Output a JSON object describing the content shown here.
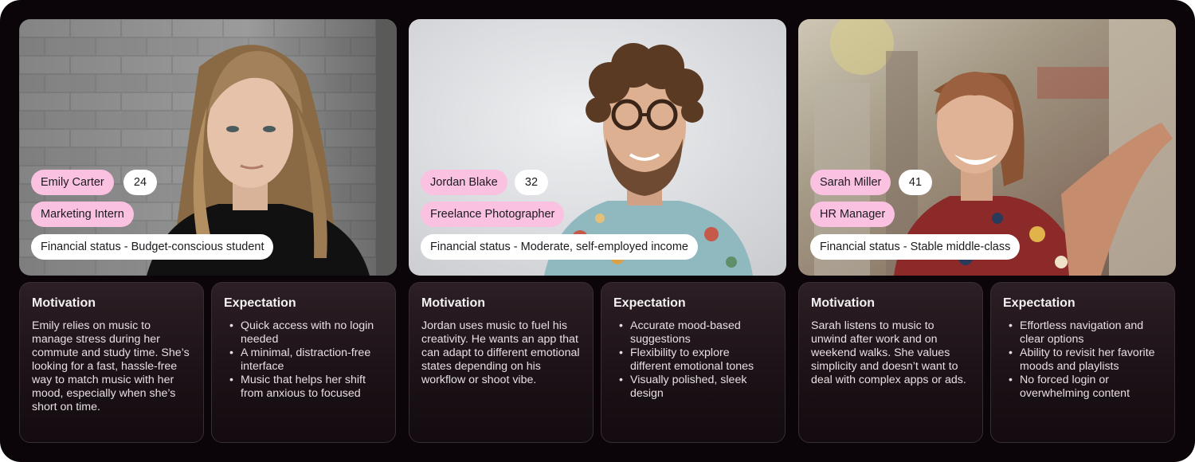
{
  "personas": [
    {
      "name": "Emily Carter",
      "age": "24",
      "role": "Marketing Intern",
      "financial_status": "Financial status - Budget-conscious student",
      "motivation_title": "Motivation",
      "motivation_text": "Emily relies on music to manage stress during her commute and study time. She’s looking for a fast, hassle-free way to match music with her mood, especially when she’s short on time.",
      "expectation_title": "Expectation",
      "expectations": [
        "Quick access with no login needed",
        "A minimal, distraction-free interface",
        "Music that helps her shift from anxious to focused"
      ]
    },
    {
      "name": "Jordan Blake",
      "age": "32",
      "role": "Freelance Photographer",
      "financial_status": "Financial status - Moderate, self-employed income",
      "motivation_title": "Motivation",
      "motivation_text": "Jordan uses music to fuel his creativity. He wants an app that can adapt to different emotional states depending on his workflow or shoot vibe.",
      "expectation_title": "Expectation",
      "expectations": [
        "Accurate mood-based suggestions",
        "Flexibility to explore different emotional tones",
        "Visually polished, sleek design"
      ]
    },
    {
      "name": "Sarah Miller",
      "age": "41",
      "role": "HR Manager",
      "financial_status": "Financial status - Stable middle-class",
      "motivation_title": "Motivation",
      "motivation_text": "Sarah listens to music to unwind after work and on weekend walks. She values simplicity and doesn’t want to deal with complex apps or ads.",
      "expectation_title": "Expectation",
      "expectations": [
        "Effortless navigation and clear options",
        "Ability to revisit her favorite moods and playlists",
        "No forced login or overwhelming content"
      ]
    }
  ]
}
